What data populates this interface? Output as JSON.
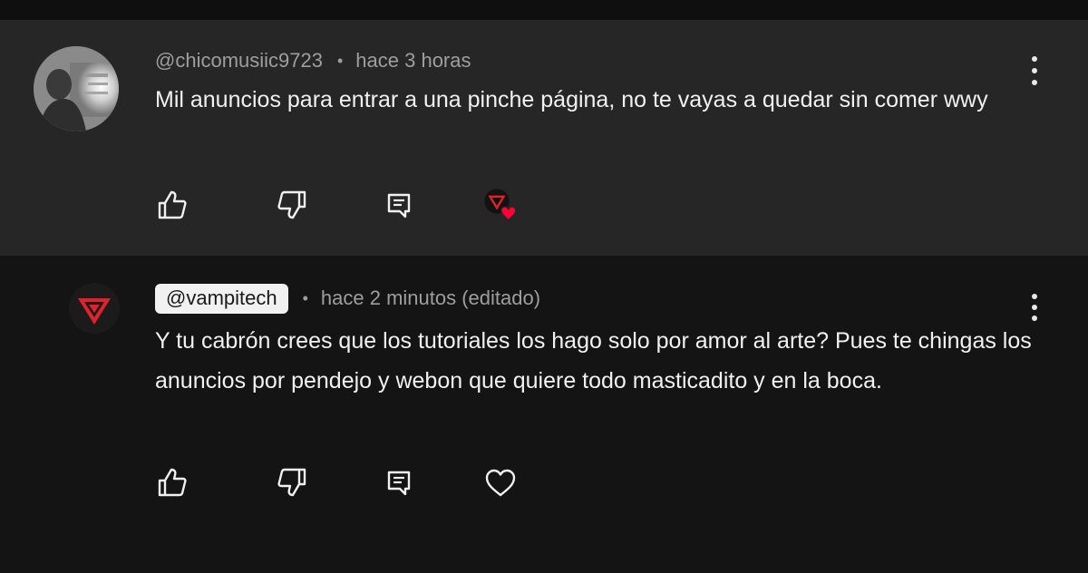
{
  "comments": [
    {
      "handle": "@chicomusiic9723",
      "time": "hace 3 horas",
      "text": "Mil anuncios para entrar a una pinche página, no te vayas a quedar sin comer wwy",
      "heart_state": "creator-hearted",
      "avatar_icon": "user-photo-avatar"
    },
    {
      "handle": "@vampitech",
      "time": "hace 2 minutos (editado)",
      "text": "Y tu cabrón crees que los tutoriales los hago solo por amor al arte? Pues te chingas los anuncios por pendejo y webon que quiere todo masticadito y en la boca.",
      "heart_state": "not-hearted",
      "avatar_icon": "vampitech-logo-avatar"
    }
  ],
  "separator": "•",
  "colors": {
    "highlighted_bg": "#262626",
    "page_bg": "#141414",
    "brand_red": "#e0222a",
    "heart_red": "#ff0033"
  }
}
